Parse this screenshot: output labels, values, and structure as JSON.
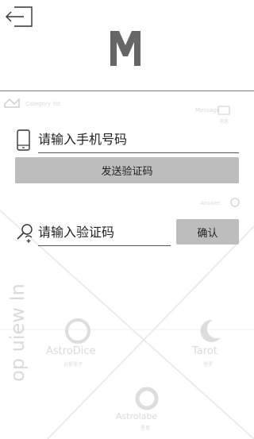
{
  "header": {
    "back_icon": "logout-arrow-icon",
    "logo_text": "M",
    "logo_color": "#666666"
  },
  "background": {
    "category": "Category list",
    "message": "Message",
    "message_sub": "消息",
    "answer": "Answer",
    "astrodice": "AstroDice",
    "astrodice_sub": "占星骰子",
    "tarot": "Tarot",
    "tarot_sub": "塔罗",
    "astrolabe": "Astrolabe",
    "astrolabe_sub": "星盘",
    "vertical_text": "op uiew In"
  },
  "form": {
    "phone_placeholder": "请输入手机号码",
    "phone_value": "",
    "send_code_label": "发送验证码",
    "code_placeholder": "请输入验证码",
    "code_value": "",
    "confirm_label": "确认"
  },
  "colors": {
    "button_bg": "#bdbdbd",
    "underline": "#555555",
    "ghost": "#bdbdbd"
  }
}
